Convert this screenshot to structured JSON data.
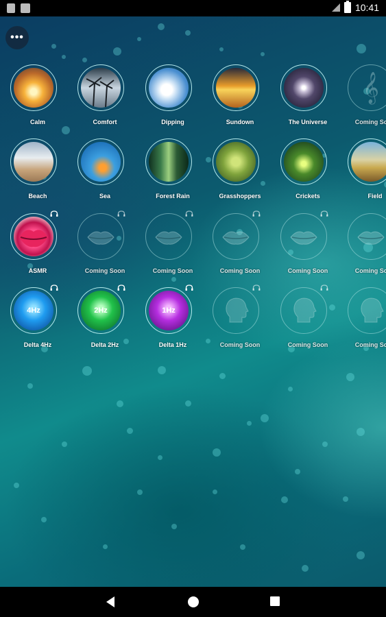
{
  "status_bar": {
    "time": "10:41",
    "icons": [
      "app-notification-icon",
      "sd-card-icon",
      "signal-icon",
      "battery-icon"
    ]
  },
  "menu": {
    "label": "•••"
  },
  "rows": [
    [
      {
        "label": "Calm",
        "art": "sunset-clouds"
      },
      {
        "label": "Comfort",
        "art": "palm-trees"
      },
      {
        "label": "Dipping",
        "art": "clouds-sky"
      },
      {
        "label": "Sundown",
        "art": "sundown"
      },
      {
        "label": "The Universe",
        "art": "galaxy"
      },
      {
        "label": "Coming Soon",
        "art": "treble-clef",
        "dim": true
      }
    ],
    [
      {
        "label": "Beach",
        "art": "beach"
      },
      {
        "label": "Sea",
        "art": "starfish-sea"
      },
      {
        "label": "Forest Rain",
        "art": "forest"
      },
      {
        "label": "Grasshoppers",
        "art": "grass"
      },
      {
        "label": "Crickets",
        "art": "crickets"
      },
      {
        "label": "Field",
        "art": "field"
      }
    ],
    [
      {
        "label": "ASMR",
        "art": "lips",
        "headphones": true
      },
      {
        "label": "Coming Soon",
        "art": "lips-outline",
        "headphones": true,
        "dim": true
      },
      {
        "label": "Coming Soon",
        "art": "lips-outline",
        "headphones": true,
        "dim": true
      },
      {
        "label": "Coming Soon",
        "art": "lips-outline",
        "headphones": true,
        "dim": true
      },
      {
        "label": "Coming Soon",
        "art": "lips-outline",
        "headphones": true,
        "dim": true
      },
      {
        "label": "Coming Soon",
        "art": "lips-outline",
        "headphones": true,
        "dim": true
      }
    ],
    [
      {
        "label": "Delta 4Hz",
        "art": "head-blue",
        "freq": "4Hz",
        "headphones": true
      },
      {
        "label": "Delta 2Hz",
        "art": "head-green",
        "freq": "2Hz",
        "headphones": true
      },
      {
        "label": "Delta 1Hz",
        "art": "head-purple",
        "freq": "1Hz",
        "headphones": true
      },
      {
        "label": "Coming Soon",
        "art": "head-outline",
        "headphones": true,
        "dim": true
      },
      {
        "label": "Coming Soon",
        "art": "head-outline",
        "headphones": true,
        "dim": true
      },
      {
        "label": "Coming Soon",
        "art": "head-outline",
        "headphones": true,
        "dim": true
      }
    ]
  ],
  "nav_bar": {
    "buttons": [
      "back-icon",
      "home-icon",
      "recent-apps-icon"
    ]
  }
}
